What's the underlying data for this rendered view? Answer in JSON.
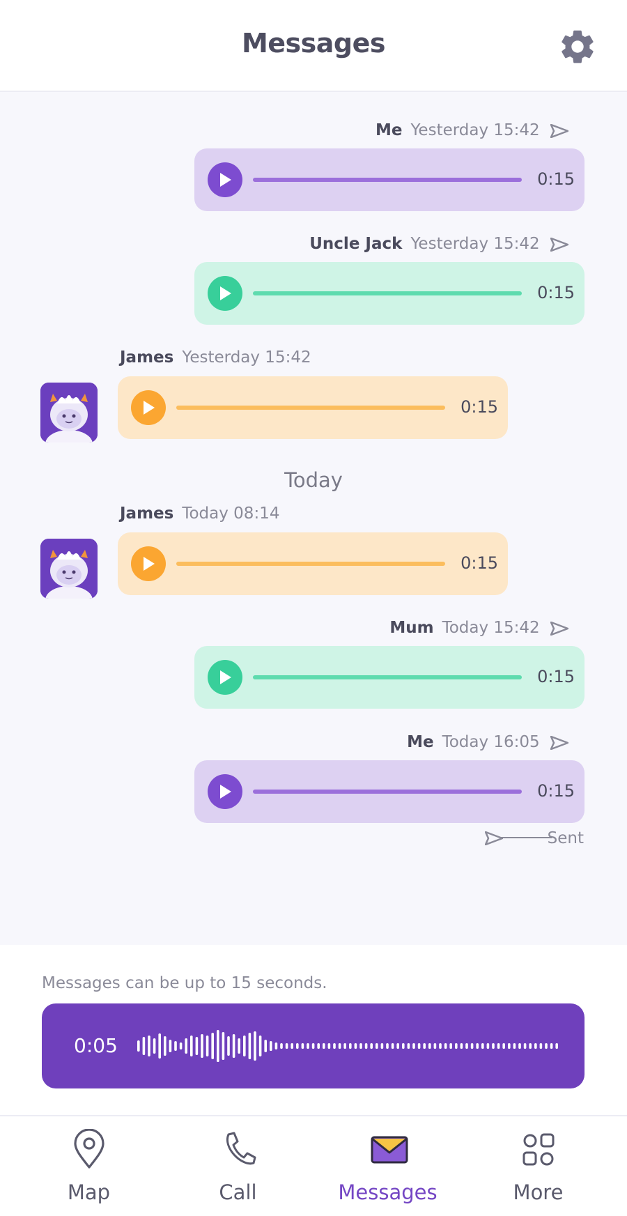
{
  "header": {
    "title": "Messages",
    "settings_icon": "gear-icon"
  },
  "messages": [
    {
      "sender": "Me",
      "time": "Yesterday 15:42",
      "duration": "0:15",
      "color": "purple",
      "direction": "out"
    },
    {
      "sender": "Uncle Jack",
      "time": "Yesterday 15:42",
      "duration": "0:15",
      "color": "green",
      "direction": "out"
    },
    {
      "sender": "James",
      "time": "Yesterday 15:42",
      "duration": "0:15",
      "color": "orange",
      "direction": "in"
    },
    {
      "sender": "James",
      "time": "Today 08:14",
      "duration": "0:15",
      "color": "orange",
      "direction": "in"
    },
    {
      "sender": "Mum",
      "time": "Today 15:42",
      "duration": "0:15",
      "color": "green",
      "direction": "out"
    },
    {
      "sender": "Me",
      "time": "Today 16:05",
      "duration": "0:15",
      "color": "purple",
      "direction": "out"
    }
  ],
  "day_separator": "Today",
  "status": {
    "sent_label": "Sent"
  },
  "composer": {
    "hint": "Messages can be up to 15 seconds.",
    "elapsed": "0:05"
  },
  "nav": {
    "items": [
      {
        "label": "Map",
        "icon": "map-pin-icon"
      },
      {
        "label": "Call",
        "icon": "phone-icon"
      },
      {
        "label": "Messages",
        "icon": "envelope-icon",
        "active": true
      },
      {
        "label": "More",
        "icon": "grid-icon"
      }
    ]
  },
  "colors": {
    "accent": "#6f40bc",
    "purple_bubble": "#ddd1f2",
    "green_bubble": "#cff4e6",
    "orange_bubble": "#fde7c8"
  }
}
